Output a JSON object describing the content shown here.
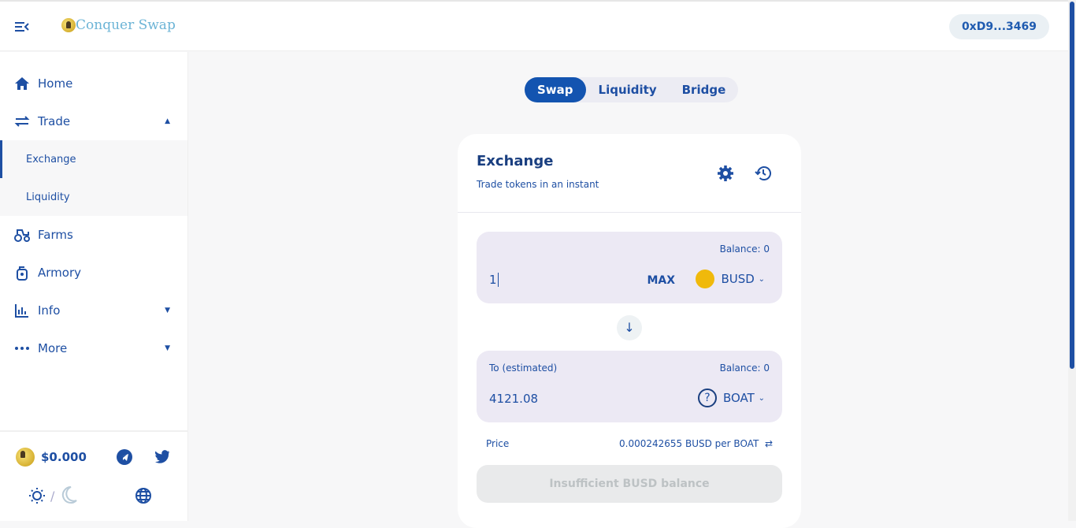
{
  "header": {
    "logo": "Conquer Swap",
    "wallet": "0xD9...3469"
  },
  "sidebar": {
    "items": [
      {
        "label": "Home"
      },
      {
        "label": "Trade"
      },
      {
        "label": "Farms"
      },
      {
        "label": "Armory"
      },
      {
        "label": "Info"
      },
      {
        "label": "More"
      }
    ],
    "trade_sub": [
      {
        "label": "Exchange"
      },
      {
        "label": "Liquidity"
      }
    ],
    "price": "$0.000"
  },
  "tabs": [
    {
      "label": "Swap"
    },
    {
      "label": "Liquidity"
    },
    {
      "label": "Bridge"
    }
  ],
  "card": {
    "title": "Exchange",
    "subtitle": "Trade tokens in an instant",
    "from": {
      "balance": "Balance: 0",
      "value": "1",
      "max": "MAX",
      "token": "BUSD"
    },
    "to": {
      "label": "To (estimated)",
      "balance": "Balance: 0",
      "value": "4121.08",
      "token": "BOAT"
    },
    "price_label": "Price",
    "price_value": "0.000242655 BUSD per BOAT",
    "button": "Insufficient BUSD balance"
  },
  "colors": {
    "accent": "#1e4fa3",
    "busd": "#f0b90b"
  }
}
